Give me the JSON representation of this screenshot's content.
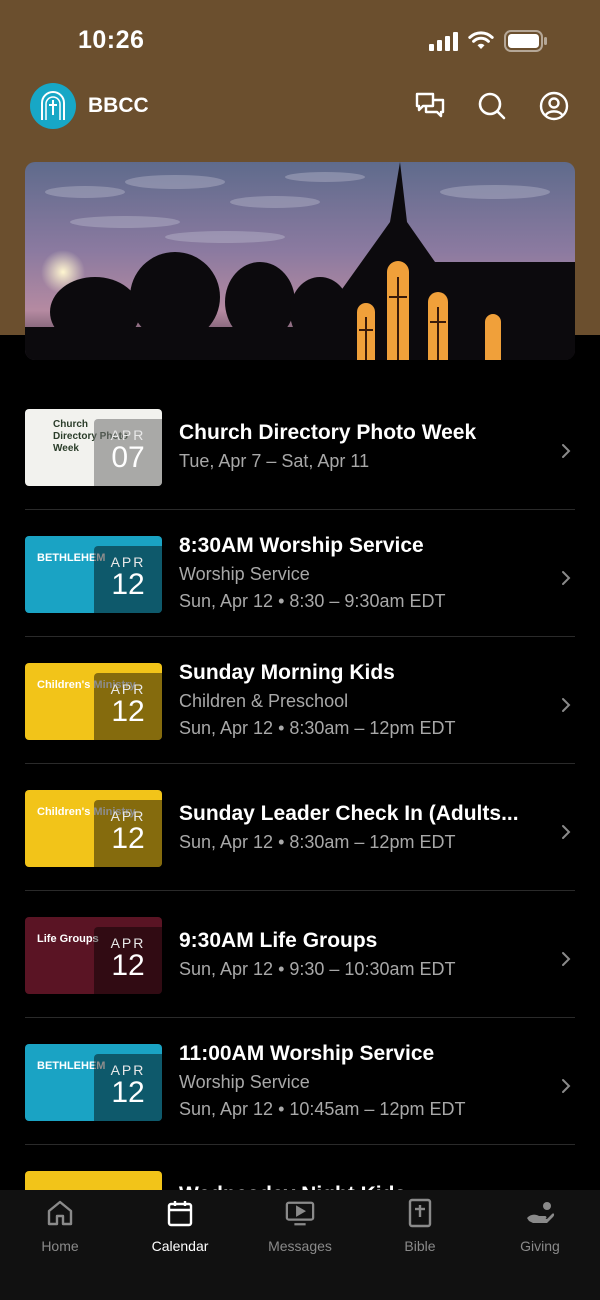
{
  "status_bar": {
    "time": "10:26"
  },
  "app": {
    "title": "BBCC"
  },
  "events": [
    {
      "thumb_style": "directory",
      "thumb_text": "Church Directory Photo Week",
      "month": "APR",
      "day": "07",
      "title": "Church Directory Photo Week",
      "lines": [
        "Tue, Apr 7 – Sat, Apr 11"
      ]
    },
    {
      "thumb_style": "bethlehem",
      "thumb_text": "BETHLEHEM",
      "month": "APR",
      "day": "12",
      "title": "8:30AM Worship Service",
      "lines": [
        "Worship Service",
        "Sun, Apr 12 • 8:30 – 9:30am EDT"
      ]
    },
    {
      "thumb_style": "children",
      "thumb_text": "Children's Ministry",
      "month": "APR",
      "day": "12",
      "title": "Sunday Morning Kids",
      "lines": [
        "Children & Preschool",
        "Sun, Apr 12 • 8:30am – 12pm EDT"
      ]
    },
    {
      "thumb_style": "children",
      "thumb_text": "Children's Ministry",
      "month": "APR",
      "day": "12",
      "title": "Sunday Leader Check In (Adults...",
      "lines": [
        "Sun, Apr 12 • 8:30am – 12pm EDT"
      ]
    },
    {
      "thumb_style": "lifegroups",
      "thumb_text": "Life Groups",
      "month": "APR",
      "day": "12",
      "title": "9:30AM Life Groups",
      "lines": [
        "Sun, Apr 12 • 9:30 – 10:30am EDT"
      ]
    },
    {
      "thumb_style": "bethlehem",
      "thumb_text": "BETHLEHEM",
      "month": "APR",
      "day": "12",
      "title": "11:00AM Worship Service",
      "lines": [
        "Worship Service",
        "Sun, Apr 12 • 10:45am – 12pm EDT"
      ]
    },
    {
      "thumb_style": "children",
      "thumb_text": "",
      "month": "",
      "day": "",
      "title": "Wednesday Night Kids",
      "lines": []
    }
  ],
  "tabs": [
    {
      "label": "Home",
      "icon": "home-icon",
      "active": false
    },
    {
      "label": "Calendar",
      "icon": "calendar-icon",
      "active": true
    },
    {
      "label": "Messages",
      "icon": "messages-icon",
      "active": false
    },
    {
      "label": "Bible",
      "icon": "bible-icon",
      "active": false
    },
    {
      "label": "Giving",
      "icon": "giving-icon",
      "active": false
    }
  ],
  "colors": {
    "header": "#6b4f2e",
    "bethlehem": "#1aa3c4",
    "children": "#f2c419",
    "lifegroups": "#5a1424",
    "directory": "#f2f2ee"
  }
}
